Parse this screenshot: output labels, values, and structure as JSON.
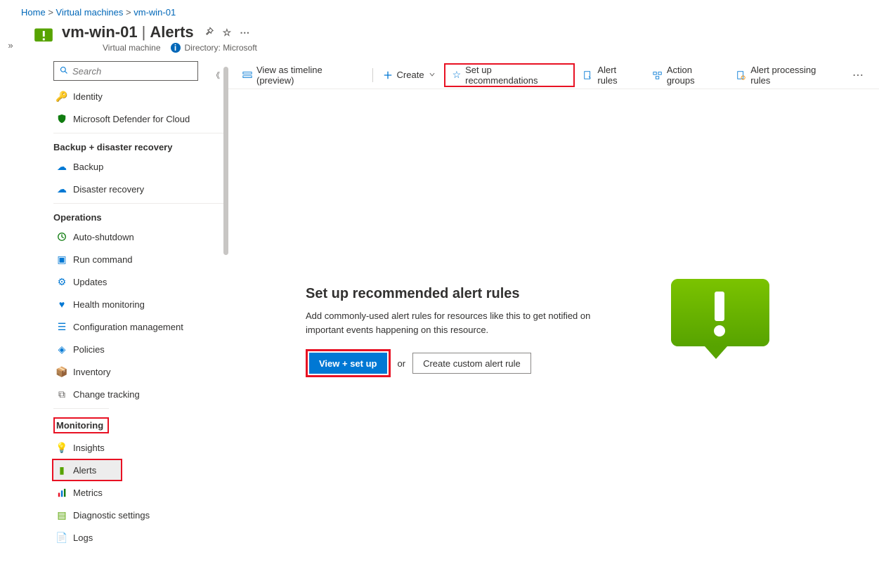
{
  "breadcrumb": {
    "home": "Home",
    "vm_list": "Virtual machines",
    "vm": "vm-win-01"
  },
  "header": {
    "title": "vm-win-01",
    "section": "Alerts",
    "subtitle_type": "Virtual machine",
    "directory_label": "Directory:",
    "directory_value": "Microsoft"
  },
  "search": {
    "placeholder": "Search"
  },
  "sidebar": {
    "loose_items": [
      {
        "label": "Identity",
        "icon": "key"
      },
      {
        "label": "Microsoft Defender for Cloud",
        "icon": "shield"
      }
    ],
    "groups": [
      {
        "label": "Backup + disaster recovery",
        "items": [
          {
            "label": "Backup",
            "icon": "backup"
          },
          {
            "label": "Disaster recovery",
            "icon": "disaster"
          }
        ]
      },
      {
        "label": "Operations",
        "items": [
          {
            "label": "Auto-shutdown",
            "icon": "clock"
          },
          {
            "label": "Run command",
            "icon": "runcmd"
          },
          {
            "label": "Updates",
            "icon": "gear"
          },
          {
            "label": "Health monitoring",
            "icon": "heart"
          },
          {
            "label": "Configuration management",
            "icon": "list"
          },
          {
            "label": "Policies",
            "icon": "policy"
          },
          {
            "label": "Inventory",
            "icon": "box"
          },
          {
            "label": "Change tracking",
            "icon": "track"
          }
        ]
      },
      {
        "label": "Monitoring",
        "highlight": true,
        "items": [
          {
            "label": "Insights",
            "icon": "insights"
          },
          {
            "label": "Alerts",
            "icon": "alerts",
            "selected": true,
            "highlight": true
          },
          {
            "label": "Metrics",
            "icon": "metrics"
          },
          {
            "label": "Diagnostic settings",
            "icon": "diag"
          },
          {
            "label": "Logs",
            "icon": "logs"
          }
        ]
      }
    ]
  },
  "toolbar": {
    "timeline": "View as timeline (preview)",
    "create": "Create",
    "setup": "Set up recommendations",
    "alert_rules": "Alert rules",
    "action_groups": "Action groups",
    "processing_rules": "Alert processing rules"
  },
  "empty": {
    "title": "Set up recommended alert rules",
    "desc": "Add commonly-used alert rules for resources like this to get notified on important events happening on this resource.",
    "primary_btn": "View + set up",
    "or": "or",
    "secondary_btn": "Create custom alert rule"
  }
}
